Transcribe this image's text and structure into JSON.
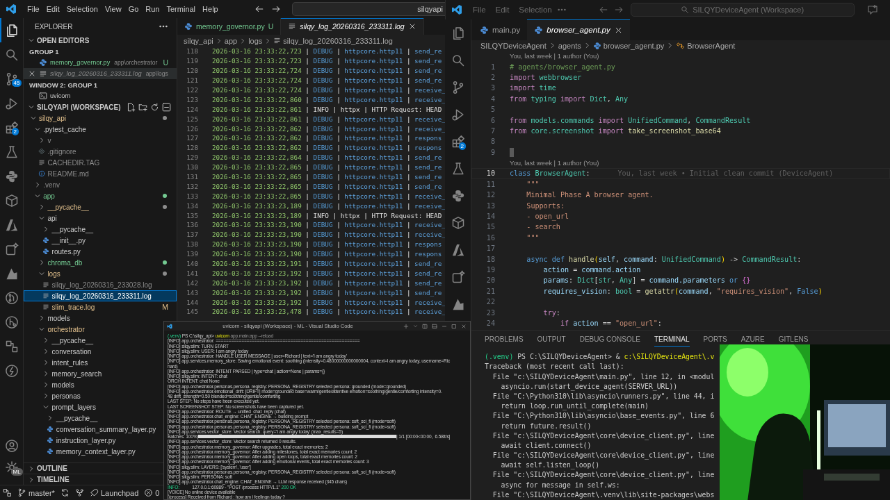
{
  "left_window": {
    "menu": [
      "File",
      "Edit",
      "Selection",
      "View",
      "Go",
      "Run",
      "Terminal",
      "Help"
    ],
    "search": {
      "value": "silqyapi"
    },
    "activity_badges": {
      "source_control": "45",
      "extensions": "2",
      "account": "ML"
    },
    "explorer": {
      "title": "EXPLORER",
      "open_editors_title": "OPEN EDITORS",
      "groups": [
        {
          "title": "GROUP 1",
          "items": [
            {
              "label": "memory_governor.py",
              "path": "app\\orchestrator",
              "decoration": "U",
              "kind": "python",
              "git": {
                "kind": "untracked"
              },
              "preview": false,
              "hovered": false
            },
            {
              "label": "silqy_log_20260316_233311.log",
              "path": "app\\logs",
              "kind": "log",
              "git": {
                "kind": "ignored"
              },
              "preview": true,
              "hovered": true
            }
          ]
        },
        {
          "title": "WINDOW 2: GROUP 1",
          "items": [
            {
              "label": "uvicorn",
              "kind": "terminal",
              "git": {
                "kind": "normal"
              },
              "preview": false,
              "hovered": false
            }
          ]
        }
      ],
      "workspace_title": "SILQYAPI (WORKSPACE)",
      "tree": [
        {
          "label": "silqy_api",
          "kind": "folder",
          "expanded": true,
          "git": {
            "kind": "modified"
          },
          "dot": {
            "color": "#8c8c8c"
          },
          "selected": false,
          "children": [
            {
              "label": ".pytest_cache",
              "kind": "folder",
              "expanded": true,
              "git": {
                "kind": "normal"
              },
              "selected": false,
              "children": [
                {
                  "label": "v",
                  "kind": "folder",
                  "expanded": false,
                  "git": {
                    "kind": "ignored"
                  },
                  "selected": false
                },
                {
                  "label": ".gitignore",
                  "kind": "config",
                  "git": {
                    "kind": "ignored"
                  },
                  "selected": false
                },
                {
                  "label": "CACHEDIR.TAG",
                  "kind": "text",
                  "git": {
                    "kind": "ignored"
                  },
                  "selected": false
                },
                {
                  "label": "README.md",
                  "kind": "info",
                  "git": {
                    "kind": "ignored"
                  },
                  "selected": false
                }
              ]
            },
            {
              "label": ".venv",
              "kind": "folder",
              "expanded": false,
              "git": {
                "kind": "ignored"
              },
              "selected": false
            },
            {
              "label": "app",
              "kind": "folder",
              "expanded": true,
              "git": {
                "kind": "untracked"
              },
              "dot": {
                "color": "#73c991"
              },
              "selected": false,
              "children": [
                {
                  "label": "__pycache__",
                  "kind": "folder",
                  "expanded": false,
                  "git": {
                    "kind": "modified"
                  },
                  "dot": {
                    "color": "#8c8c8c"
                  },
                  "selected": false
                },
                {
                  "label": "api",
                  "kind": "folder",
                  "expanded": true,
                  "git": {
                    "kind": "normal"
                  },
                  "selected": false,
                  "children": [
                    {
                      "label": "__pycache__",
                      "kind": "folder",
                      "expanded": false,
                      "git": {
                        "kind": "normal"
                      },
                      "selected": false
                    },
                    {
                      "label": "__init__.py",
                      "kind": "python",
                      "git": {
                        "kind": "normal"
                      },
                      "selected": false
                    },
                    {
                      "label": "routes.py",
                      "kind": "python",
                      "git": {
                        "kind": "normal"
                      },
                      "selected": false
                    }
                  ]
                },
                {
                  "label": "chroma_db",
                  "kind": "folder",
                  "expanded": false,
                  "git": {
                    "kind": "untracked"
                  },
                  "dot": {
                    "color": "#73c991"
                  },
                  "selected": false
                },
                {
                  "label": "logs",
                  "kind": "folder",
                  "expanded": true,
                  "git": {
                    "kind": "modified"
                  },
                  "dot": {
                    "color": "#8c8c8c"
                  },
                  "selected": false,
                  "children": [
                    {
                      "label": "silqy_log_20260316_233028.log",
                      "kind": "text",
                      "git": {
                        "kind": "ignored"
                      },
                      "selected": false
                    },
                    {
                      "label": "silqy_log_20260316_233311.log",
                      "kind": "text",
                      "git": {
                        "kind": "normal"
                      },
                      "selected": true
                    },
                    {
                      "label": "slim_trace.log",
                      "kind": "text",
                      "git": {
                        "kind": "modified"
                      },
                      "decoration": "M",
                      "selected": false
                    }
                  ]
                },
                {
                  "label": "models",
                  "kind": "folder",
                  "expanded": false,
                  "git": {
                    "kind": "normal"
                  },
                  "selected": false
                },
                {
                  "label": "orchestrator",
                  "kind": "folder",
                  "expanded": true,
                  "git": {
                    "kind": "modified"
                  },
                  "selected": false,
                  "children": [
                    {
                      "label": "__pycache__",
                      "kind": "folder",
                      "expanded": false,
                      "git": {
                        "kind": "normal"
                      },
                      "selected": false
                    },
                    {
                      "label": "conversation",
                      "kind": "folder",
                      "expanded": false,
                      "git": {
                        "kind": "normal"
                      },
                      "selected": false
                    },
                    {
                      "label": "intent_rules",
                      "kind": "folder",
                      "expanded": false,
                      "git": {
                        "kind": "normal"
                      },
                      "selected": false
                    },
                    {
                      "label": "memory_search",
                      "kind": "folder",
                      "expanded": false,
                      "git": {
                        "kind": "normal"
                      },
                      "selected": false
                    },
                    {
                      "label": "models",
                      "kind": "folder",
                      "expanded": false,
                      "git": {
                        "kind": "normal"
                      },
                      "selected": false
                    },
                    {
                      "label": "personas",
                      "kind": "folder",
                      "expanded": false,
                      "git": {
                        "kind": "normal"
                      },
                      "selected": false
                    },
                    {
                      "label": "prompt_layers",
                      "kind": "folder",
                      "expanded": true,
                      "git": {
                        "kind": "normal"
                      },
                      "selected": false,
                      "children": [
                        {
                          "label": "__pycache__",
                          "kind": "folder",
                          "expanded": false,
                          "git": {
                            "kind": "normal"
                          },
                          "selected": false
                        },
                        {
                          "label": "conversation_summary_layer.py",
                          "kind": "python",
                          "git": {
                            "kind": "normal"
                          },
                          "selected": false
                        },
                        {
                          "label": "instruction_layer.py",
                          "kind": "python",
                          "git": {
                            "kind": "normal"
                          },
                          "selected": false
                        },
                        {
                          "label": "memory_context_layer.py",
                          "kind": "python",
                          "git": {
                            "kind": "normal"
                          },
                          "selected": false
                        }
                      ]
                    }
                  ]
                }
              ]
            }
          ]
        }
      ],
      "outline": "OUTLINE",
      "timeline": "TIMELINE"
    },
    "editor": {
      "tabs": [
        {
          "label": "memory_governor.py",
          "decoration": "U",
          "kind": "python",
          "selected": false,
          "preview": false
        },
        {
          "label": "silqy_log_20260316_233311.log",
          "kind": "log",
          "selected": true,
          "preview": true
        }
      ],
      "breadcrumb": [
        "silqy_api",
        "app",
        "logs",
        "silqy_log_20260316_233311.log"
      ],
      "log_lines": [
        {
          "number": "118",
          "time": "2026-03-16 23:33:22,723",
          "separator": "|",
          "level": "DEBUG",
          "kind": "debug",
          "logger": "httpcore.http11",
          "message": "send_re"
        },
        {
          "number": "119",
          "time": "2026-03-16 23:33:22,723",
          "separator": "|",
          "level": "DEBUG",
          "kind": "debug",
          "logger": "httpcore.http11",
          "message": "send_re"
        },
        {
          "number": "120",
          "time": "2026-03-16 23:33:22,724",
          "separator": "|",
          "level": "DEBUG",
          "kind": "debug",
          "logger": "httpcore.http11",
          "message": "send_re"
        },
        {
          "number": "121",
          "time": "2026-03-16 23:33:22,724",
          "separator": "|",
          "level": "DEBUG",
          "kind": "debug",
          "logger": "httpcore.http11",
          "message": "send_re"
        },
        {
          "number": "122",
          "time": "2026-03-16 23:33:22,724",
          "separator": "|",
          "level": "DEBUG",
          "kind": "debug",
          "logger": "httpcore.http11",
          "message": "receive_"
        },
        {
          "number": "123",
          "time": "2026-03-16 23:33:22,860",
          "separator": "|",
          "level": "DEBUG",
          "kind": "debug",
          "logger": "httpcore.http11",
          "message": "receive_"
        },
        {
          "number": "124",
          "time": "2026-03-16 23:33:22,861",
          "separator": "|",
          "level": "INFO",
          "kind": "info",
          "logger": "httpx",
          "message": "HTTP Request: HEAD"
        },
        {
          "number": "125",
          "time": "2026-03-16 23:33:22,861",
          "separator": "|",
          "level": "DEBUG",
          "kind": "debug",
          "logger": "httpcore.http11",
          "message": "receive_"
        },
        {
          "number": "126",
          "time": "2026-03-16 23:33:22,862",
          "separator": "|",
          "level": "DEBUG",
          "kind": "debug",
          "logger": "httpcore.http11",
          "message": "receive_"
        },
        {
          "number": "127",
          "time": "2026-03-16 23:33:22,862",
          "separator": "|",
          "level": "DEBUG",
          "kind": "debug",
          "logger": "httpcore.http11",
          "message": "respons"
        },
        {
          "number": "128",
          "time": "2026-03-16 23:33:22,862",
          "separator": "|",
          "level": "DEBUG",
          "kind": "debug",
          "logger": "httpcore.http11",
          "message": "respons"
        },
        {
          "number": "129",
          "time": "2026-03-16 23:33:22,864",
          "separator": "|",
          "level": "DEBUG",
          "kind": "debug",
          "logger": "httpcore.http11",
          "message": "send_re"
        },
        {
          "number": "130",
          "time": "2026-03-16 23:33:22,865",
          "separator": "|",
          "level": "DEBUG",
          "kind": "debug",
          "logger": "httpcore.http11",
          "message": "send_re"
        },
        {
          "number": "131",
          "time": "2026-03-16 23:33:22,865",
          "separator": "|",
          "level": "DEBUG",
          "kind": "debug",
          "logger": "httpcore.http11",
          "message": "send_re"
        },
        {
          "number": "132",
          "time": "2026-03-16 23:33:22,865",
          "separator": "|",
          "level": "DEBUG",
          "kind": "debug",
          "logger": "httpcore.http11",
          "message": "send_re"
        },
        {
          "number": "133",
          "time": "2026-03-16 23:33:22,865",
          "separator": "|",
          "level": "DEBUG",
          "kind": "debug",
          "logger": "httpcore.http11",
          "message": "receive_"
        },
        {
          "number": "134",
          "time": "2026-03-16 23:33:23,189",
          "separator": "|",
          "level": "DEBUG",
          "kind": "debug",
          "logger": "httpcore.http11",
          "message": "receive_"
        },
        {
          "number": "135",
          "time": "2026-03-16 23:33:23,189",
          "separator": "|",
          "level": "INFO",
          "kind": "info",
          "logger": "httpx",
          "message": "HTTP Request: HEAD"
        },
        {
          "number": "136",
          "time": "2026-03-16 23:33:23,190",
          "separator": "|",
          "level": "DEBUG",
          "kind": "debug",
          "logger": "httpcore.http11",
          "message": "receive_"
        },
        {
          "number": "137",
          "time": "2026-03-16 23:33:23,190",
          "separator": "|",
          "level": "DEBUG",
          "kind": "debug",
          "logger": "httpcore.http11",
          "message": "receive_"
        },
        {
          "number": "138",
          "time": "2026-03-16 23:33:23,190",
          "separator": "|",
          "level": "DEBUG",
          "kind": "debug",
          "logger": "httpcore.http11",
          "message": "respons"
        },
        {
          "number": "139",
          "time": "2026-03-16 23:33:23,190",
          "separator": "|",
          "level": "DEBUG",
          "kind": "debug",
          "logger": "httpcore.http11",
          "message": "respons"
        },
        {
          "number": "140",
          "time": "2026-03-16 23:33:23,191",
          "separator": "|",
          "level": "DEBUG",
          "kind": "debug",
          "logger": "httpcore.http11",
          "message": "send_re"
        },
        {
          "number": "141",
          "time": "2026-03-16 23:33:23,192",
          "separator": "|",
          "level": "DEBUG",
          "kind": "debug",
          "logger": "httpcore.http11",
          "message": "send_re"
        },
        {
          "number": "142",
          "time": "2026-03-16 23:33:23,192",
          "separator": "|",
          "level": "DEBUG",
          "kind": "debug",
          "logger": "httpcore.http11",
          "message": "send_re"
        },
        {
          "number": "143",
          "time": "2026-03-16 23:33:23,192",
          "separator": "|",
          "level": "DEBUG",
          "kind": "debug",
          "logger": "httpcore.http11",
          "message": "send_re"
        },
        {
          "number": "144",
          "time": "2026-03-16 23:33:23,192",
          "separator": "|",
          "level": "DEBUG",
          "kind": "debug",
          "logger": "httpcore.http11",
          "message": "receive_"
        },
        {
          "number": "145",
          "time": "2026-03-16 23:33:23,478",
          "separator": "|",
          "level": "DEBUG",
          "kind": "debug",
          "logger": "httpcore.http11",
          "message": "receive_"
        }
      ]
    },
    "status_bar": {
      "branch": "master*",
      "launchpad": "Launchpad",
      "errors": "0"
    }
  },
  "right_window": {
    "menu": [
      "File",
      "Edit",
      "Selection"
    ],
    "search": {
      "value": "SILQYDeviceAgent (Workspace)"
    },
    "activity_badges": {
      "extensions": "2"
    },
    "tabs": [
      {
        "label": "main.py",
        "kind": "python",
        "selected": false,
        "preview": false
      },
      {
        "label": "browser_agent.py",
        "kind": "python",
        "selected": true,
        "preview": true
      }
    ],
    "breadcrumb": [
      "SILQYDeviceAgent",
      "agents",
      "browser_agent.py",
      "BrowserAgent"
    ],
    "code_lines": [
      {
        "number": "1",
        "codelens": "You, last week | 1 author (You)",
        "kind": "code",
        "current": false,
        "tokens": [
          {
            "text": "# agents/browser_agent.py",
            "kind": "cmt"
          }
        ]
      },
      {
        "number": "2",
        "kind": "code",
        "current": false,
        "tokens": [
          {
            "text": "import",
            "kind": "kw"
          },
          {
            "text": " webbrowser",
            "kind": "type"
          }
        ]
      },
      {
        "number": "3",
        "kind": "code",
        "current": false,
        "tokens": [
          {
            "text": "import",
            "kind": "kw"
          },
          {
            "text": " time",
            "kind": "type"
          }
        ]
      },
      {
        "number": "4",
        "kind": "code",
        "current": false,
        "tokens": [
          {
            "text": "from",
            "kind": "kw"
          },
          {
            "text": " typing",
            "kind": "type"
          },
          {
            "text": " import",
            "kind": "kw"
          },
          {
            "text": " Dict",
            "kind": "type"
          },
          {
            "text": ",",
            "kind": "plain"
          },
          {
            "text": " Any",
            "kind": "type"
          }
        ]
      },
      {
        "number": "5",
        "kind": "blank",
        "current": false
      },
      {
        "number": "6",
        "kind": "code",
        "current": false,
        "tokens": [
          {
            "text": "from",
            "kind": "kw"
          },
          {
            "text": " models.commands",
            "kind": "type"
          },
          {
            "text": " import",
            "kind": "kw"
          },
          {
            "text": " UnifiedCommand",
            "kind": "type"
          },
          {
            "text": ",",
            "kind": "plain"
          },
          {
            "text": " CommandResult",
            "kind": "type"
          }
        ]
      },
      {
        "number": "7",
        "kind": "code",
        "current": false,
        "tokens": [
          {
            "text": "from",
            "kind": "kw"
          },
          {
            "text": " core.screenshot",
            "kind": "type"
          },
          {
            "text": " import",
            "kind": "kw"
          },
          {
            "text": " take_screenshot_base64",
            "kind": "fn"
          }
        ]
      },
      {
        "number": "8",
        "kind": "blank",
        "current": false
      },
      {
        "number": "9",
        "kind": "cursor",
        "current": false
      },
      {
        "number": "10",
        "codelens": "You, last week | 1 author (You)",
        "blame": "You, last week • Initial clean commit (DeviceAgent)",
        "kind": "code",
        "current": true,
        "tokens": [
          {
            "text": "class",
            "kind": "decl"
          },
          {
            "text": " BrowserAgent",
            "kind": "type"
          },
          {
            "text": ":",
            "kind": "plain"
          }
        ]
      },
      {
        "number": "11",
        "kind": "code",
        "current": false,
        "tokens": [
          {
            "text": "    \"\"\"",
            "kind": "str"
          }
        ]
      },
      {
        "number": "12",
        "kind": "code",
        "current": false,
        "tokens": [
          {
            "text": "    Minimal Phase A browser agent.",
            "kind": "str"
          }
        ]
      },
      {
        "number": "13",
        "kind": "code",
        "current": false,
        "tokens": [
          {
            "text": "    Supports:",
            "kind": "str"
          }
        ]
      },
      {
        "number": "14",
        "kind": "code",
        "current": false,
        "tokens": [
          {
            "text": "    - open_url",
            "kind": "str"
          }
        ]
      },
      {
        "number": "15",
        "kind": "code",
        "current": false,
        "tokens": [
          {
            "text": "    - search",
            "kind": "str"
          }
        ]
      },
      {
        "number": "16",
        "kind": "code",
        "current": false,
        "tokens": [
          {
            "text": "    \"\"\"",
            "kind": "str"
          }
        ]
      },
      {
        "number": "17",
        "kind": "blank",
        "current": false
      },
      {
        "number": "18",
        "kind": "code",
        "current": false,
        "tokens": [
          {
            "text": "    async def",
            "kind": "decl"
          },
          {
            "text": " handle",
            "kind": "fn"
          },
          {
            "text": "(",
            "kind": "brace"
          },
          {
            "text": "self",
            "kind": "var"
          },
          {
            "text": ",",
            "kind": "plain"
          },
          {
            "text": " command",
            "kind": "var"
          },
          {
            "text": ":",
            "kind": "plain"
          },
          {
            "text": " UnifiedCommand",
            "kind": "type"
          },
          {
            "text": ")",
            "kind": "brace"
          },
          {
            "text": " ->",
            "kind": "plain"
          },
          {
            "text": " CommandResult",
            "kind": "type"
          },
          {
            "text": ":",
            "kind": "plain"
          }
        ]
      },
      {
        "number": "19",
        "kind": "code",
        "current": false,
        "tokens": [
          {
            "text": "        action",
            "kind": "var"
          },
          {
            "text": " =",
            "kind": "plain"
          },
          {
            "text": " command.action",
            "kind": "var"
          }
        ]
      },
      {
        "number": "20",
        "kind": "code",
        "current": false,
        "tokens": [
          {
            "text": "        params",
            "kind": "var"
          },
          {
            "text": ":",
            "kind": "plain"
          },
          {
            "text": " Dict",
            "kind": "type"
          },
          {
            "text": "[",
            "kind": "plain"
          },
          {
            "text": "str",
            "kind": "type"
          },
          {
            "text": ",",
            "kind": "plain"
          },
          {
            "text": " Any",
            "kind": "type"
          },
          {
            "text": "] =",
            "kind": "plain"
          },
          {
            "text": " command.parameters",
            "kind": "var"
          },
          {
            "text": " or",
            "kind": "decl"
          },
          {
            "text": " {}",
            "kind": "brace2"
          }
        ]
      },
      {
        "number": "21",
        "kind": "code",
        "current": false,
        "tokens": [
          {
            "text": "        requires_vision",
            "kind": "var"
          },
          {
            "text": ":",
            "kind": "plain"
          },
          {
            "text": " bool",
            "kind": "type"
          },
          {
            "text": " =",
            "kind": "plain"
          },
          {
            "text": " getattr",
            "kind": "fn"
          },
          {
            "text": "(",
            "kind": "brace"
          },
          {
            "text": "command",
            "kind": "var"
          },
          {
            "text": ",",
            "kind": "plain"
          },
          {
            "text": " \"requires_vision\"",
            "kind": "str"
          },
          {
            "text": ",",
            "kind": "plain"
          },
          {
            "text": " False",
            "kind": "decl"
          },
          {
            "text": ")",
            "kind": "brace"
          }
        ]
      },
      {
        "number": "22",
        "kind": "blank",
        "current": false
      },
      {
        "number": "23",
        "kind": "code",
        "current": false,
        "tokens": [
          {
            "text": "        try",
            "kind": "kw"
          },
          {
            "text": ":",
            "kind": "plain"
          }
        ]
      },
      {
        "number": "24",
        "kind": "code",
        "current": false,
        "tokens": [
          {
            "text": "            if",
            "kind": "kw"
          },
          {
            "text": " action",
            "kind": "var"
          },
          {
            "text": " ==",
            "kind": "plain"
          },
          {
            "text": " \"open_url\"",
            "kind": "str"
          },
          {
            "text": ":",
            "kind": "plain"
          }
        ]
      }
    ],
    "panel": {
      "tabs": [
        {
          "label": "PROBLEMS",
          "selected": false
        },
        {
          "label": "OUTPUT",
          "selected": false
        },
        {
          "label": "DEBUG CONSOLE",
          "selected": false
        },
        {
          "label": "TERMINAL",
          "selected": true
        },
        {
          "label": "PORTS",
          "selected": false
        },
        {
          "label": "AZURE",
          "selected": false
        },
        {
          "label": "GITLENS",
          "selected": false
        }
      ],
      "terminal": [
        {
          "kind": "prompt",
          "env": "(.venv)",
          "path": "PS C:\\SILQYDeviceAgent>",
          "operator": "&",
          "command": "c:\\SILQYDeviceAgent\\.v"
        },
        {
          "kind": "text",
          "text": "Traceback (most recent call last):"
        },
        {
          "kind": "text",
          "text": "  File \"c:\\SILQYDeviceAgent\\main.py\", line 12, in <modul"
        },
        {
          "kind": "text",
          "text": "    asyncio.run(start_device_agent(SERVER_URL))"
        },
        {
          "kind": "text",
          "text": "  File \"C:\\Python310\\lib\\asyncio\\runners.py\", line 44, i"
        },
        {
          "kind": "text",
          "text": "    return loop.run_until_complete(main)"
        },
        {
          "kind": "text",
          "text": "  File \"C:\\Python310\\lib\\asyncio\\base_events.py\", line 6"
        },
        {
          "kind": "text",
          "text": "    return future.result()"
        },
        {
          "kind": "text",
          "text": "  File \"c:\\SILQYDeviceAgent\\core\\device_client.py\", line"
        },
        {
          "kind": "text",
          "text": "    await client.connect()"
        },
        {
          "kind": "text",
          "text": "  File \"c:\\SILQYDeviceAgent\\core\\device_client.py\", line"
        },
        {
          "kind": "text",
          "text": "    await self.listen_loop()"
        },
        {
          "kind": "text",
          "text": "  File \"c:\\SILQYDeviceAgent\\core\\device_client.py\", line"
        },
        {
          "kind": "text",
          "text": "    async for message in self.ws:"
        },
        {
          "kind": "text",
          "text": "  File \"C:\\SILQYDeviceAgent\\.venv\\lib\\site-packages\\webs"
        }
      ]
    }
  },
  "terminal_window": {
    "title": "uvicorn - silqyapi (Workspace) - ML - Visual Studio Code",
    "prompt": {
      "env": "(.venv)",
      "path": "PS C:\\silqy_api>",
      "command": "uvicorn",
      "args": "app.main:app --reload"
    },
    "lines": [
      {
        "kind": "text",
        "text": "[INFO] app.orchestrator: ========================================================"
      },
      {
        "kind": "text",
        "text": "[INFO] silqy.slim: TURN START"
      },
      {
        "kind": "text",
        "text": "[INFO] silqy.slim: USER: I am angry today"
      },
      {
        "kind": "text",
        "text": "[INFO] app.orchestrator: HANDLE USER MESSAGE | user=Richard | text='I am angry today'"
      },
      {
        "kind": "text",
        "text": "[INFO] app.services.memory_store: Saving emotional event: soothing (intensity=0.48000000000000004, context=I am angry today, username=Ric"
      },
      {
        "kind": "text",
        "text": "hard)"
      },
      {
        "kind": "text",
        "text": "[INFO] app.orchestrator: INTENT PARSED | type=chat | action=None | params={}"
      },
      {
        "kind": "text",
        "text": "[INFO] silqy.slim: INTENT: chat"
      },
      {
        "kind": "text",
        "text": "ORCH INTENT: chat None"
      },
      {
        "kind": "text",
        "text": "[INFO] app.orchestrator.personas.persona_registry: PERSONA_REGISTRY selected persona: grounded (mode=grounded)"
      },
      {
        "kind": "text",
        "text": "[INFO] app.orchestrator.emotional_drift: [DRIFT] mode=grounded base=warm/gentle/attentive emotion=soothing/gentle/comforting intensity=0."
      },
      {
        "kind": "text",
        "text": "48 drift_strength=0.50 blended=soothing/gentle/comforting"
      },
      {
        "kind": "text",
        "text": "LAST STEP: No steps have been executed yet."
      },
      {
        "kind": "text",
        "text": "LAST SCREENSHOT STEP: No screenshots have been captured yet."
      },
      {
        "kind": "text",
        "text": "[INFO] app.orchestrator: ROUTE → unified_chat_reply (chat)"
      },
      {
        "kind": "text",
        "text": "[INFO] app.orchestrator.chat_engine: CHAT_ENGINE → building prompt"
      },
      {
        "kind": "text",
        "text": "[INFO] app.orchestrator.personas.persona_registry: PERSONA_REGISTRY selected persona: soft_sci_fi (mode=soft)"
      },
      {
        "kind": "text",
        "text": "[INFO] app.orchestrator.personas.persona_registry: PERSONA_REGISTRY selected persona: soft_sci_fi (mode=soft)"
      },
      {
        "kind": "text",
        "text": "[INFO] app.services.vector_store: Vector search: query='I am angry today' (max_results=5)"
      },
      {
        "kind": "progress",
        "prefix": "Batches: 100%|",
        "level": 1,
        "suffix": "| 1/1 [00:00<00:00,  6.58it/s]"
      },
      {
        "kind": "text",
        "text": "[INFO] app.services.vector_store: Vector search returned 0 results."
      },
      {
        "kind": "text",
        "text": "[INFO] app.orchestrator.memory_governor: After upgrades, total exact memories: 2"
      },
      {
        "kind": "text",
        "text": "[INFO] app.orchestrator.memory_governor: After adding milestones, total exact memories count: 2"
      },
      {
        "kind": "text",
        "text": "[INFO] app.orchestrator.memory_governor: After adding open loops, total exact memories count: 2"
      },
      {
        "kind": "text",
        "text": "[INFO] app.orchestrator.memory_governor: After adding emotional events, total exact memories count: 3"
      },
      {
        "kind": "text",
        "text": "[INFO] silqy.slim: LAYERS: ['system', 'user']"
      },
      {
        "kind": "text",
        "text": "[INFO] app.orchestrator.personas.persona_registry: PERSONA_REGISTRY selected persona: soft_sci_fi (mode=soft)"
      },
      {
        "kind": "text",
        "text": "[INFO] silqy.slim: PERSONA: soft"
      },
      {
        "kind": "text",
        "text": "[INFO] app.orchestrator.chat_engine: CHAT_ENGINE → LLM response received (345 chars)"
      },
      {
        "kind": "access",
        "level": "INFO:",
        "text": "127.0.0.1:60889 - \"POST /process HTTP/1.1\"",
        "code": "200 OK"
      },
      {
        "kind": "text",
        "text": "[VOICE] No online device available"
      },
      {
        "kind": "text",
        "text": "[/process] Received from Richard : how am i feelingn today ?"
      }
    ]
  }
}
